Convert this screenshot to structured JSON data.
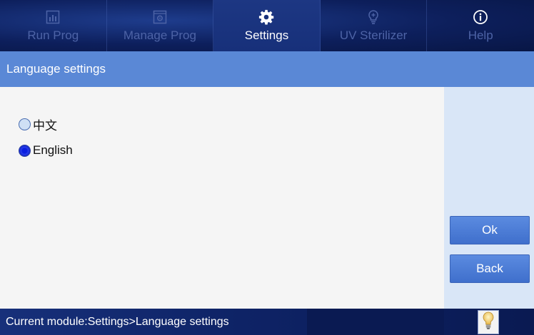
{
  "nav": {
    "tabs": [
      {
        "label": "Run Prog",
        "icon": "bar-chart-icon",
        "active": false
      },
      {
        "label": "Manage Prog",
        "icon": "gear-document-icon",
        "active": false
      },
      {
        "label": "Settings",
        "icon": "gear-icon",
        "active": true
      },
      {
        "label": "UV Sterilizer",
        "icon": "uv-bulb-icon",
        "active": false
      },
      {
        "label": "Help",
        "icon": "info-icon",
        "active": false
      }
    ]
  },
  "section": {
    "title": "Language settings"
  },
  "language": {
    "options": [
      {
        "label": "中文",
        "selected": false
      },
      {
        "label": "English",
        "selected": true
      }
    ]
  },
  "actions": {
    "ok_label": "Ok",
    "back_label": "Back"
  },
  "status": {
    "text": "Current module:Settings>Language settings",
    "icon": "lightbulb-icon"
  },
  "colors": {
    "nav_bg": "#0d1f5c",
    "header_bg": "#5a88d6",
    "button_bg": "#4a7bd8",
    "side_panel": "#d9e6f7",
    "radio_selected": "#1a2fd8"
  }
}
